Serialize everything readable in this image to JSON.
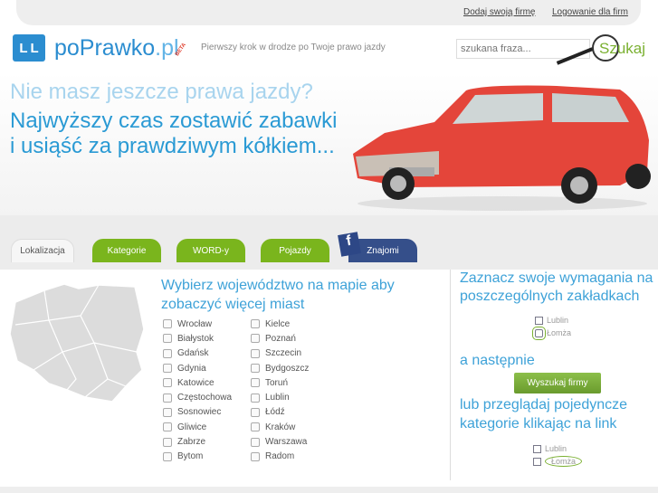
{
  "top_links": [
    "Dodaj swoją firmę",
    "Logowanie dla firm"
  ],
  "logo": {
    "mark": "LL",
    "name": "poPrawko",
    "tld": ".pl",
    "badge": "BETA"
  },
  "tagline": "Pierwszy krok w drodze po Twoje prawo jazdy",
  "search": {
    "placeholder": "szukana fraza...",
    "button": "Szukaj"
  },
  "hero": {
    "line1": "Nie masz jeszcze prawa jazdy?",
    "line2": "Najwyższy czas zostawić zabawki",
    "line3": "i usiąść za prawdziwym kółkiem..."
  },
  "tabs": [
    "Lokalizacja",
    "Kategorie",
    "WORD-y",
    "Pojazdy",
    "Znajomi"
  ],
  "location": {
    "title": "Wybierz województwo na mapie aby zobaczyć więcej miast",
    "col1": [
      "Wrocław",
      "Białystok",
      "Gdańsk",
      "Gdynia",
      "Katowice",
      "Częstochowa",
      "Sosnowiec",
      "Gliwice",
      "Zabrze",
      "Bytom"
    ],
    "col2": [
      "Kielce",
      "Poznań",
      "Szczecin",
      "Bydgoszcz",
      "Toruń",
      "Lublin",
      "Łódź",
      "Kraków",
      "Warszawa",
      "Radom"
    ]
  },
  "help": {
    "line1": "Zaznacz swoje wymagania na",
    "line2": "poszczególnych zakładkach",
    "example": [
      "Lublin",
      "Łomża"
    ],
    "then": "a następnie",
    "button": "Wyszukaj firmy",
    "line3": "lub przeglądaj pojedyncze",
    "line4": "kategorie klikając na link"
  }
}
